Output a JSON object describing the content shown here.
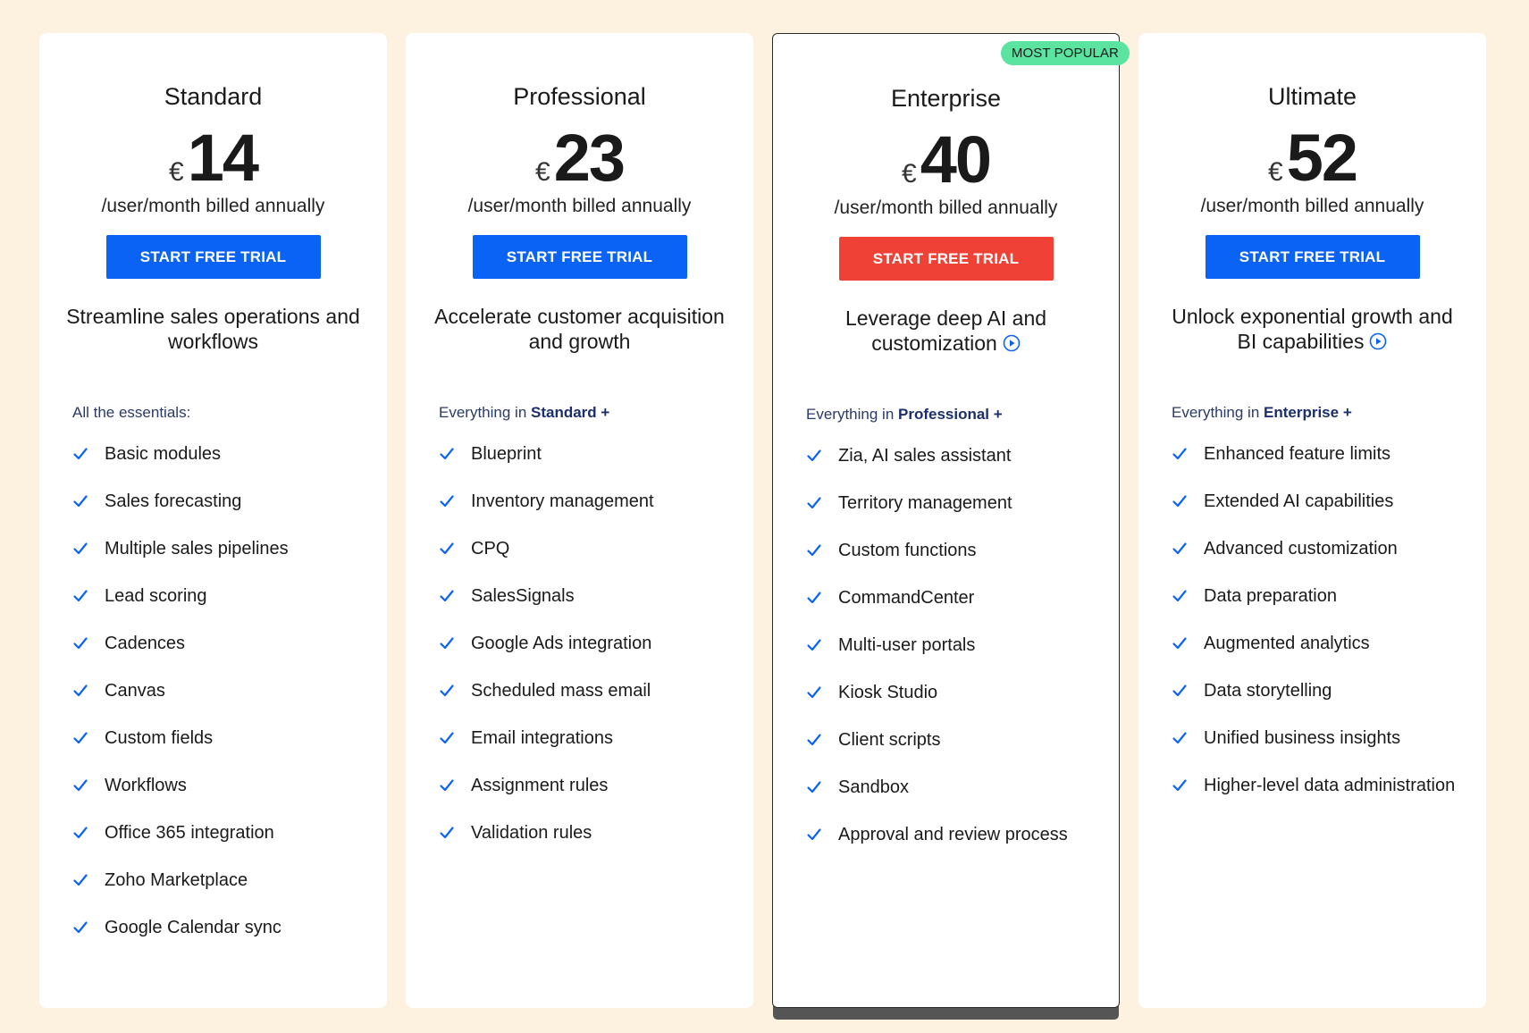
{
  "plans": [
    {
      "name": "Standard",
      "currency": "€",
      "price": "14",
      "billing": "/user/month billed annually",
      "cta": "START FREE TRIAL",
      "tagline": "Streamline sales operations and workflows",
      "features_heading": {
        "prefix": "All the essentials:",
        "plan": "",
        "suffix": ""
      },
      "features": [
        "Basic modules",
        "Sales forecasting",
        "Multiple sales pipelines",
        "Lead scoring",
        "Cadences",
        "Canvas",
        "Custom fields",
        "Workflows",
        "Office 365 integration",
        "Zoho Marketplace",
        "Google Calendar sync"
      ]
    },
    {
      "name": "Professional",
      "currency": "€",
      "price": "23",
      "billing": "/user/month billed annually",
      "cta": "START FREE TRIAL",
      "tagline": "Accelerate customer acquisition and growth",
      "features_heading": {
        "prefix": "Everything in ",
        "plan": "Standard",
        "suffix": " +"
      },
      "features": [
        "Blueprint",
        "Inventory management",
        "CPQ",
        "SalesSignals",
        "Google Ads integration",
        "Scheduled mass email",
        "Email integrations",
        "Assignment rules",
        "Validation rules"
      ]
    },
    {
      "name": "Enterprise",
      "badge": "MOST POPULAR",
      "currency": "€",
      "price": "40",
      "billing": "/user/month billed annually",
      "cta": "START FREE TRIAL",
      "tagline": "Leverage deep AI and customization",
      "features_heading": {
        "prefix": "Everything in ",
        "plan": "Professional",
        "suffix": " +"
      },
      "features": [
        "Zia, AI sales assistant",
        "Territory management",
        "Custom functions",
        "CommandCenter",
        "Multi-user portals",
        "Kiosk Studio",
        "Client scripts",
        "Sandbox",
        "Approval and review process"
      ]
    },
    {
      "name": "Ultimate",
      "currency": "€",
      "price": "52",
      "billing": "/user/month billed annually",
      "cta": "START FREE TRIAL",
      "tagline": "Unlock exponential growth and BI capabilities",
      "features_heading": {
        "prefix": "Everything in ",
        "plan": "Enterprise",
        "suffix": " +"
      },
      "features": [
        "Enhanced feature limits",
        "Extended AI capabilities",
        "Advanced customization",
        "Data preparation",
        "Augmented analytics",
        "Data storytelling",
        "Unified business insights",
        "Higher-level data administration"
      ]
    }
  ],
  "icons": {
    "check": "check-icon",
    "play": "play-circle-icon"
  },
  "colors": {
    "background": "#fdf1e0",
    "cta_blue": "#0b63f6",
    "cta_red": "#ef4136",
    "badge": "#5be3a0",
    "check": "#0b63f6"
  }
}
